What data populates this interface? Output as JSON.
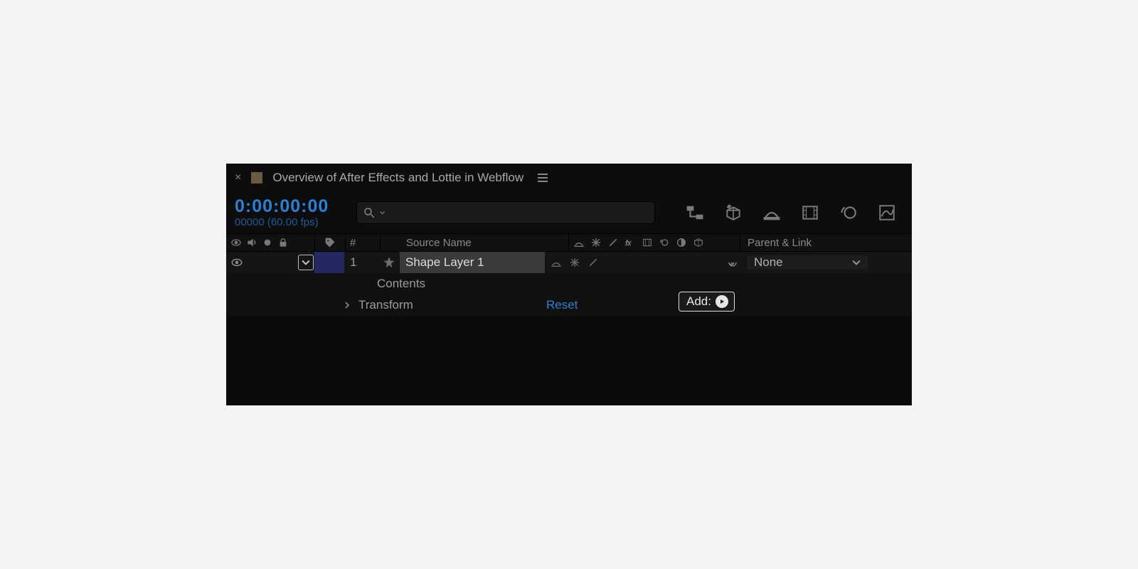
{
  "tab": {
    "title": "Overview of After Effects and Lottie in Webflow"
  },
  "time": {
    "timecode": "0:00:00:00",
    "frames": "00000 (60.00 fps)"
  },
  "search": {
    "placeholder": ""
  },
  "columns": {
    "num": "#",
    "sourceName": "Source Name",
    "parentLink": "Parent & Link"
  },
  "layer": {
    "index": "1",
    "name": "Shape Layer 1",
    "parent": "None"
  },
  "sub": {
    "contents": "Contents",
    "transform": "Transform",
    "reset": "Reset",
    "addLabel": "Add:"
  }
}
